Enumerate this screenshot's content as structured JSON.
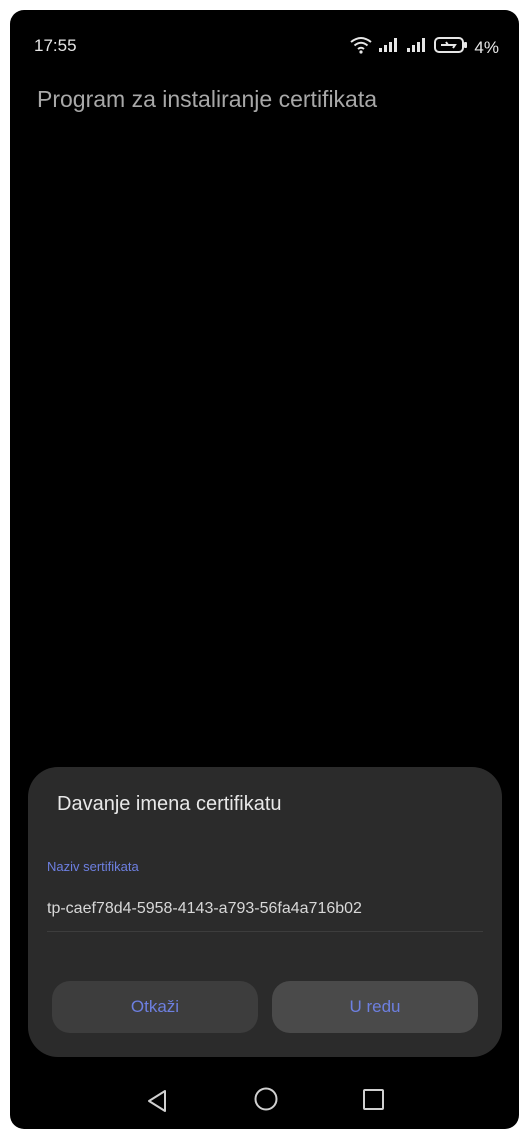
{
  "status_bar": {
    "time": "17:55",
    "battery_percent": "4%",
    "icons": [
      "wifi-icon",
      "signal-icon",
      "signal-icon",
      "battery-charging-icon"
    ]
  },
  "app": {
    "title": "Program za instaliranje certifikata"
  },
  "dialog": {
    "title": "Davanje imena certifikatu",
    "field_label": "Naziv sertifikata",
    "field_value": "tp-caef78d4-5958-4143-a793-56fa4a716b02",
    "cancel_label": "Otkaži",
    "ok_label": "U redu"
  },
  "navbar": {
    "icons": [
      "back-icon",
      "home-icon",
      "recents-icon"
    ]
  },
  "colors": {
    "accent": "#6d7fe0",
    "dialog_bg": "#2b2b2b",
    "button_bg": "#3d3d3d"
  }
}
